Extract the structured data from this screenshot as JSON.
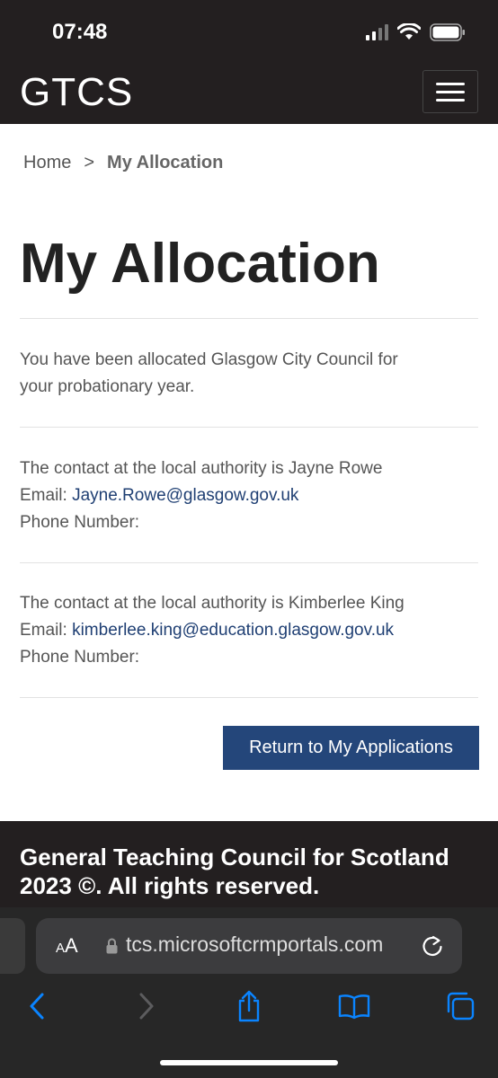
{
  "status": {
    "time": "07:48"
  },
  "header": {
    "brand": "GTCS"
  },
  "breadcrumb": {
    "home": "Home",
    "separator": ">",
    "current": "My Allocation"
  },
  "page": {
    "title": "My Allocation"
  },
  "allocation": {
    "line1": "You have been allocated Glasgow City Council for",
    "line2": "your probationary year."
  },
  "contacts": [
    {
      "intro": "The contact at the local authority is Jayne Rowe",
      "email_label": "Email:",
      "email": "Jayne.Rowe@glasgow.gov.uk",
      "phone_label": "Phone Number:"
    },
    {
      "intro": "The contact at the local authority is Kimberlee King",
      "email_label": "Email:",
      "email": "kimberlee.king@education.glasgow.gov.uk",
      "phone_label": "Phone Number:"
    }
  ],
  "actions": {
    "return_label": "Return to My Applications"
  },
  "footer": {
    "line1": "General Teaching Council for Scotland",
    "line2": "2023 ©. All rights reserved."
  },
  "browser": {
    "aa_small": "A",
    "aa_big": "A",
    "url": "tcs.microsoftcrmportals.com"
  },
  "colors": {
    "header_bg": "#231f20",
    "button_bg": "#24467a",
    "link": "#1f3f73",
    "ios_blue": "#0a84ff"
  }
}
